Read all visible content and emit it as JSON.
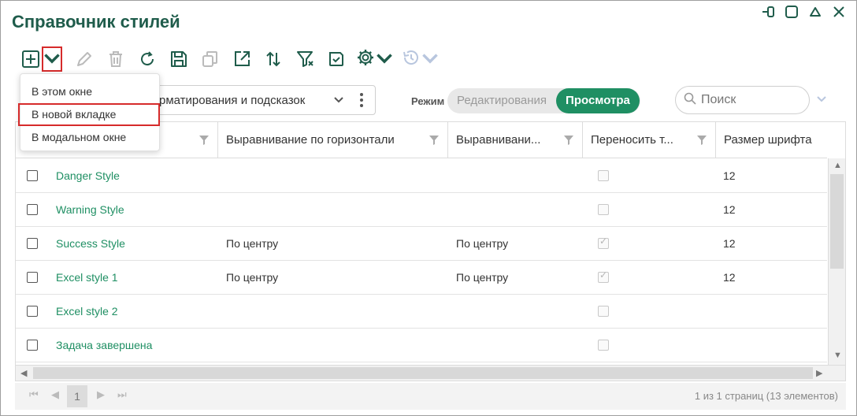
{
  "window": {
    "title": "Справочник стилей",
    "controls": [
      "minimize-icon",
      "maximize-icon",
      "collapse-icon",
      "close-icon"
    ]
  },
  "toolbar": {
    "icons": [
      "add-icon",
      "chevron-down-icon",
      "edit-icon",
      "delete-icon",
      "refresh-icon",
      "save-icon",
      "copy-icon",
      "open-external-icon",
      "sort-icon",
      "filter-clear-icon",
      "save-view-icon",
      "settings-icon",
      "history-icon"
    ]
  },
  "add_menu": {
    "items": [
      "В этом окне",
      "В новой вкладке",
      "В модальном окне"
    ],
    "highlighted_index": 1
  },
  "view_select": {
    "value": "рматирования и подсказок"
  },
  "mode": {
    "label": "Режим",
    "options": [
      "Редактирования",
      "Просмотра"
    ],
    "active": "Просмотра"
  },
  "search": {
    "placeholder": "Поиск"
  },
  "grid": {
    "columns": [
      "",
      "Выравнивание по горизонтали",
      "Выравнивани...",
      "Переносить т...",
      "Размер шрифта"
    ],
    "rows": [
      {
        "name": "Danger Style",
        "h_align": "",
        "v_align": "",
        "wrap": false,
        "font_size": "12"
      },
      {
        "name": "Warning Style",
        "h_align": "",
        "v_align": "",
        "wrap": false,
        "font_size": "12"
      },
      {
        "name": "Success Style",
        "h_align": "По центру",
        "v_align": "По центру",
        "wrap": true,
        "font_size": "12"
      },
      {
        "name": "Excel style 1",
        "h_align": "По центру",
        "v_align": "По центру",
        "wrap": true,
        "font_size": "12"
      },
      {
        "name": "Excel style 2",
        "h_align": "",
        "v_align": "",
        "wrap": false,
        "font_size": ""
      },
      {
        "name": "Задача завершена",
        "h_align": "",
        "v_align": "",
        "wrap": false,
        "font_size": ""
      }
    ]
  },
  "pager": {
    "current_page": "1",
    "info": "1 из 1 страниц (13 элементов)"
  },
  "colors": {
    "accent": "#1f8f63",
    "title": "#1f5c4b",
    "highlight": "#d62b2b"
  }
}
